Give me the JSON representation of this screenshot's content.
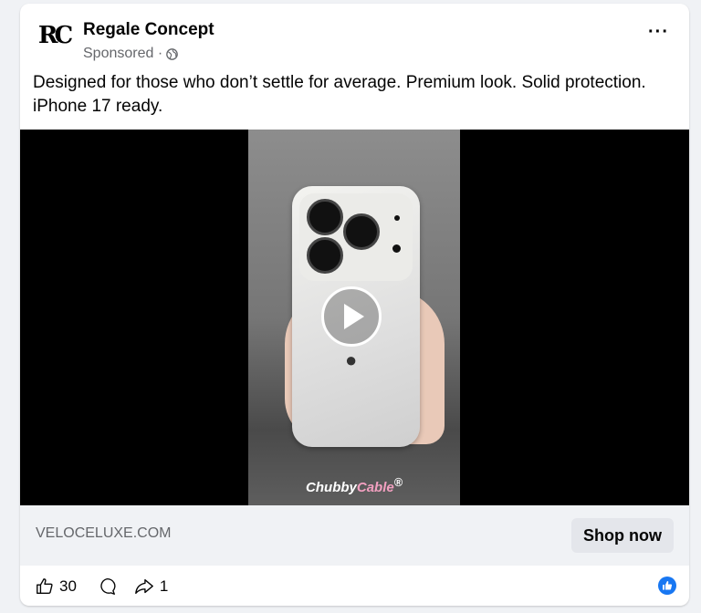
{
  "post": {
    "page_name": "Regale Concept",
    "avatar_text": "RC",
    "sponsored_label": "Sponsored ·",
    "visibility_icon": "globe-icon",
    "more_icon": "more-options-icon",
    "more_label": "···",
    "caption": "Designed for those who don’t settle for average. Premium look. Solid protection. iPhone 17 ready."
  },
  "video": {
    "watermark_main": "Chubby",
    "watermark_accent": "Cable",
    "watermark_mark": "®",
    "play_icon": "play-icon"
  },
  "cta": {
    "domain": "VELOCELUXE.COM",
    "button_label": "Shop now"
  },
  "engagement": {
    "like_icon": "thumbs-up-icon",
    "like_count": "30",
    "comment_icon": "comment-icon",
    "share_icon": "share-icon",
    "share_count": "1",
    "reaction_icon": "like-reaction-icon"
  },
  "colors": {
    "brand_blue": "#1877f2",
    "background": "#f0f2f5",
    "secondary_text": "#65676b"
  }
}
